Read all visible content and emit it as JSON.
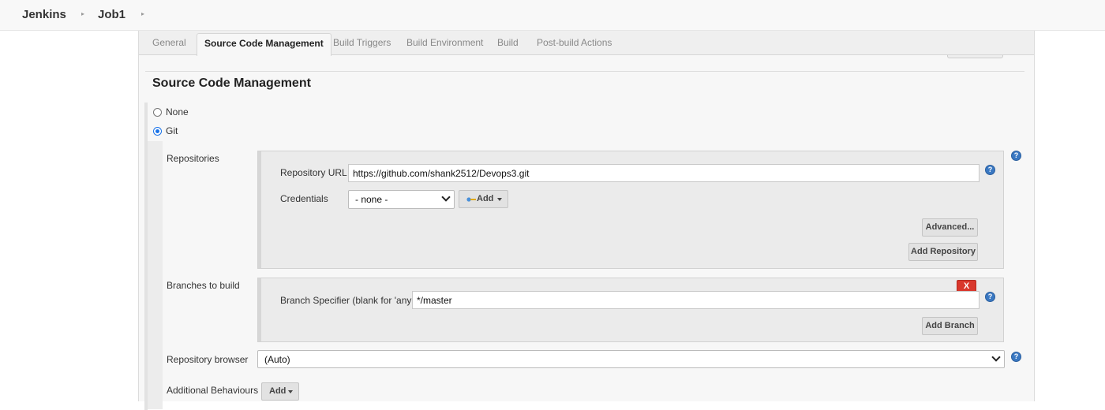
{
  "breadcrumb": {
    "items": [
      "Jenkins",
      "Job1"
    ]
  },
  "tabs": [
    "General",
    "Source Code Management",
    "Build Triggers",
    "Build Environment",
    "Build",
    "Post-build Actions"
  ],
  "active_tab": "Source Code Management",
  "section": {
    "title": "Source Code Management"
  },
  "scm": {
    "options": [
      {
        "label": "None",
        "selected": false
      },
      {
        "label": "Git",
        "selected": true
      }
    ]
  },
  "repositories": {
    "label": "Repositories",
    "url_label": "Repository URL",
    "url_value": "https://github.com/shank2512/Devops3.git",
    "credentials_label": "Credentials",
    "credentials_value": "- none -",
    "add_label": "Add",
    "advanced_label": "Advanced...",
    "add_repository_label": "Add Repository"
  },
  "branches": {
    "label": "Branches to build",
    "delete_label": "X",
    "specifier_label": "Branch Specifier (blank for 'any')",
    "specifier_value": "*/master",
    "add_branch_label": "Add Branch"
  },
  "repository_browser": {
    "label": "Repository browser",
    "value": "(Auto)"
  },
  "additional_behaviours": {
    "label": "Additional Behaviours",
    "add_label": "Add"
  },
  "help_symbol": "?",
  "colors": {
    "accent": "#1a73e8",
    "help": "#3a78c2",
    "delete": "#d9372c"
  }
}
